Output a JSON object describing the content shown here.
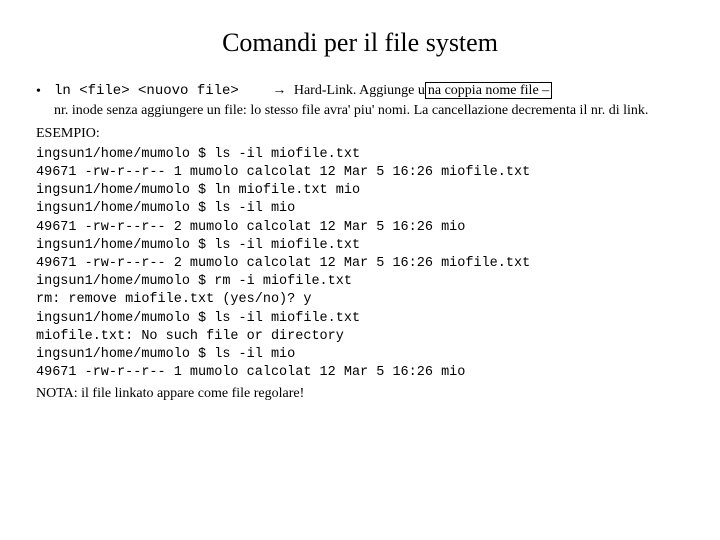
{
  "title": "Comandi per il file system",
  "bullet": {
    "dot": "•",
    "cmd": "ln <file> <nuovo file>",
    "arrow": "→",
    "desc_inline": "Hard-Link. Aggiunge u",
    "desc_boxed": "na coppia nome file –",
    "desc_cont": "nr. inode senza aggiungere un file: lo stesso file avra' piu' nomi. La cancellazione decrementa il nr. di link."
  },
  "esempio_label": "ESEMPIO:",
  "terminal": "ingsun1/home/mumolo $ ls -il miofile.txt\n49671 -rw-r--r-- 1 mumolo calcolat 12 Mar 5 16:26 miofile.txt\ningsun1/home/mumolo $ ln miofile.txt mio\ningsun1/home/mumolo $ ls -il mio\n49671 -rw-r--r-- 2 mumolo calcolat 12 Mar 5 16:26 mio\ningsun1/home/mumolo $ ls -il miofile.txt\n49671 -rw-r--r-- 2 mumolo calcolat 12 Mar 5 16:26 miofile.txt\ningsun1/home/mumolo $ rm -i miofile.txt\nrm: remove miofile.txt (yes/no)? y\ningsun1/home/mumolo $ ls -il miofile.txt\nmiofile.txt: No such file or directory\ningsun1/home/mumolo $ ls -il mio\n49671 -rw-r--r-- 1 mumolo calcolat 12 Mar 5 16:26 mio",
  "nota": "NOTA: il file linkato appare come file regolare!"
}
